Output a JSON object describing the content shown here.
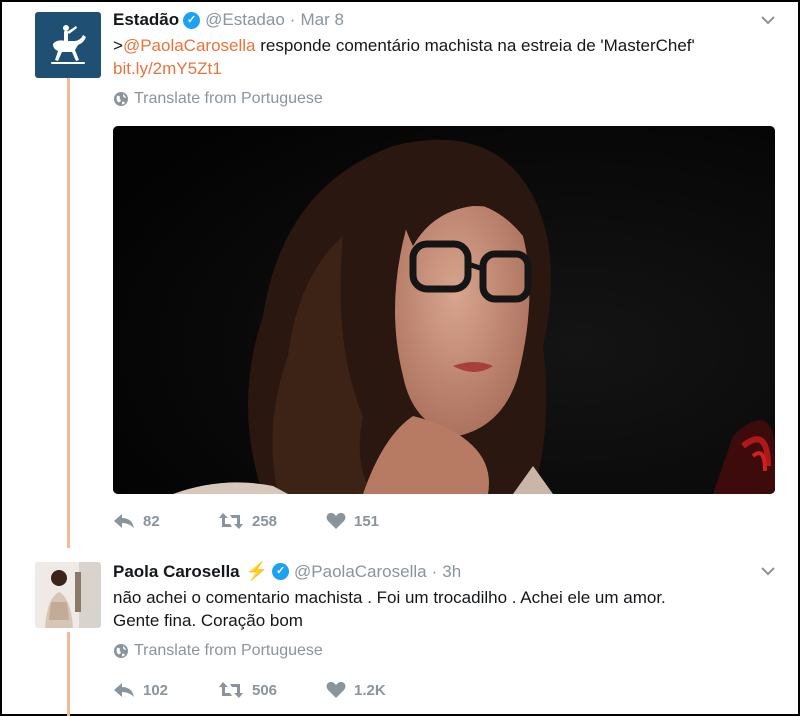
{
  "tweets": [
    {
      "name": "Estadão",
      "handle": "@Estadao",
      "separator": "·",
      "time": "Mar 8",
      "text_prefix": ">",
      "mention": "@PaolaCarosella",
      "text_body": " responde comentário machista na estreia de 'MasterChef'",
      "link": "bit.ly/2mY5Zt1",
      "translate": "Translate from Portuguese",
      "actions": {
        "replies": "82",
        "retweets": "258",
        "likes": "151"
      }
    },
    {
      "name": "Paola Carosella",
      "handle": "@PaolaCarosella",
      "separator": "·",
      "time": "3h",
      "text_line1": "não achei o comentario machista . Foi um trocadilho . Achei ele um amor.",
      "text_line2": "Gente fina. Coração bom",
      "translate": "Translate from Portuguese",
      "actions": {
        "replies": "102",
        "retweets": "506",
        "likes": "1.2K"
      }
    }
  ],
  "icons": {
    "verified": "✓",
    "bolt": "⚡",
    "accent_link": "#e8743b",
    "thread_line": "#f5b99a"
  }
}
